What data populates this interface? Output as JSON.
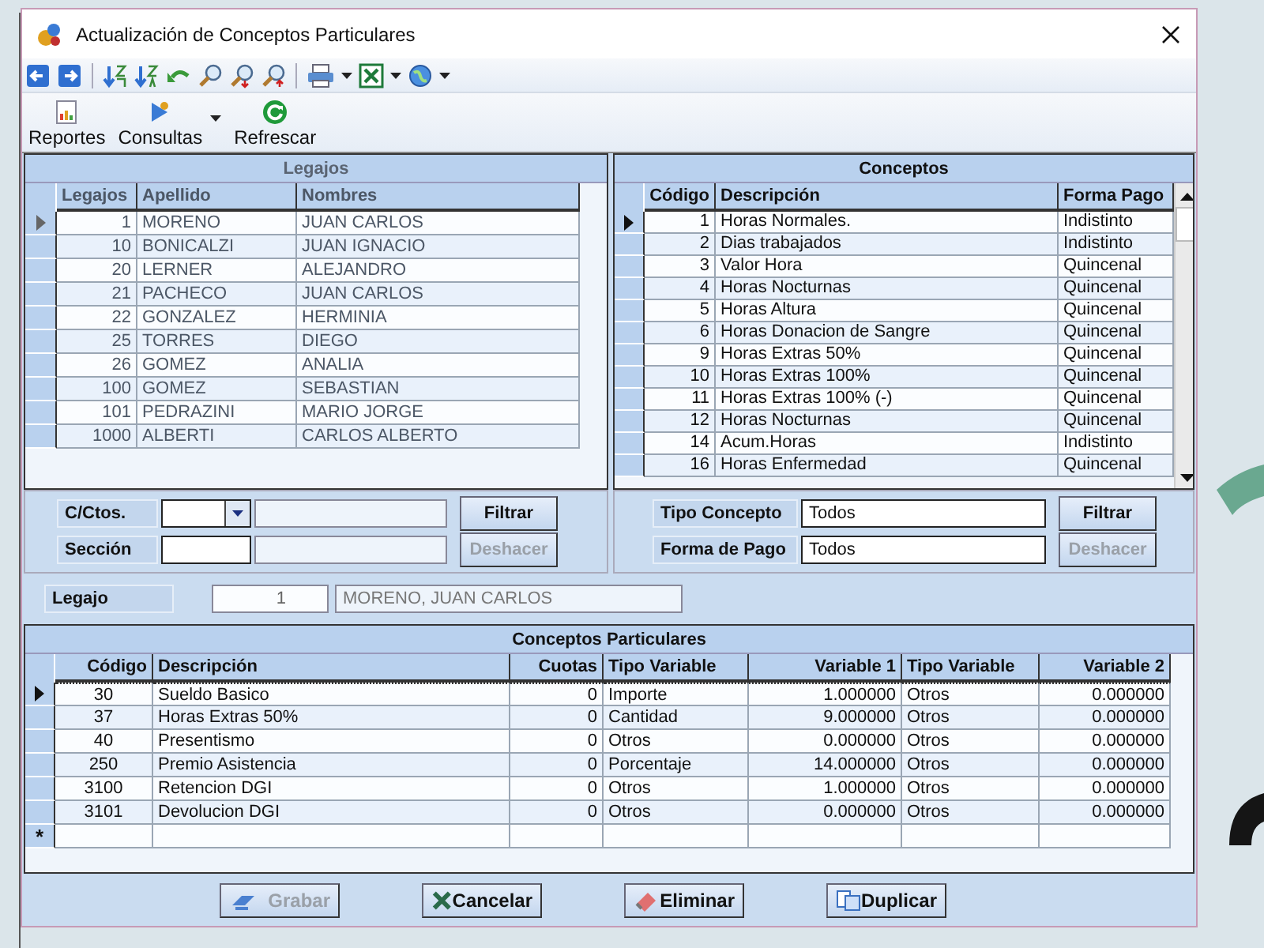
{
  "window": {
    "title": "Actualización de Conceptos Particulares"
  },
  "ribbon": [
    {
      "label": "Reportes",
      "kind": "report",
      "dropdown": false
    },
    {
      "label": "Consultas",
      "kind": "query",
      "dropdown": true
    },
    {
      "label": "Refrescar",
      "kind": "refresh",
      "dropdown": false
    }
  ],
  "legajos": {
    "title": "Legajos",
    "disabled": true,
    "columns": [
      "Legajos",
      "Apellido",
      "Nombres"
    ],
    "rows": [
      {
        "cells": [
          "1",
          "MORENO",
          "JUAN CARLOS"
        ],
        "selected": true
      },
      {
        "cells": [
          "10",
          "BONICALZI",
          "JUAN IGNACIO"
        ],
        "selected": false
      },
      {
        "cells": [
          "20",
          "LERNER",
          "ALEJANDRO"
        ],
        "selected": false
      },
      {
        "cells": [
          "21",
          "PACHECO",
          "JUAN CARLOS"
        ],
        "selected": false
      },
      {
        "cells": [
          "22",
          "GONZALEZ",
          "HERMINIA"
        ],
        "selected": false
      },
      {
        "cells": [
          "25",
          "TORRES",
          "DIEGO"
        ],
        "selected": false
      },
      {
        "cells": [
          "26",
          "GOMEZ",
          "ANALIA"
        ],
        "selected": false
      },
      {
        "cells": [
          "100",
          "GOMEZ",
          "SEBASTIAN"
        ],
        "selected": false
      },
      {
        "cells": [
          "101",
          "PEDRAZINI",
          "MARIO JORGE"
        ],
        "selected": false
      },
      {
        "cells": [
          "1000",
          "ALBERTI",
          "CARLOS ALBERTO"
        ],
        "selected": false
      }
    ]
  },
  "conceptos": {
    "title": "Conceptos",
    "disabled": false,
    "columns": [
      "Código",
      "Descripción",
      "Forma Pago"
    ],
    "rows": [
      {
        "cells": [
          "1",
          "Horas Normales.",
          "Indistinto"
        ],
        "selected": true
      },
      {
        "cells": [
          "2",
          "Dias trabajados",
          "Indistinto"
        ],
        "selected": false
      },
      {
        "cells": [
          "3",
          "Valor Hora",
          "Quincenal"
        ],
        "selected": false
      },
      {
        "cells": [
          "4",
          "Horas Nocturnas",
          "Quincenal"
        ],
        "selected": false
      },
      {
        "cells": [
          "5",
          "Horas Altura",
          "Quincenal"
        ],
        "selected": false
      },
      {
        "cells": [
          "6",
          "Horas Donacion de Sangre",
          "Quincenal"
        ],
        "selected": false
      },
      {
        "cells": [
          "9",
          "Horas Extras 50%",
          "Quincenal"
        ],
        "selected": false
      },
      {
        "cells": [
          "10",
          "Horas Extras 100%",
          "Quincenal"
        ],
        "selected": false
      },
      {
        "cells": [
          "11",
          "Horas Extras 100% (-)",
          "Quincenal"
        ],
        "selected": false
      },
      {
        "cells": [
          "12",
          "Horas Nocturnas",
          "Quincenal"
        ],
        "selected": false
      },
      {
        "cells": [
          "14",
          "Acum.Horas",
          "Indistinto"
        ],
        "selected": false
      },
      {
        "cells": [
          "16",
          "Horas Enfermedad",
          "Quincenal"
        ],
        "selected": false
      }
    ]
  },
  "filters_left": {
    "rows": [
      {
        "label": "C/Ctos.",
        "kind": "combo",
        "value": "",
        "button": {
          "label": "Filtrar",
          "disabled": false
        }
      },
      {
        "label": "Sección",
        "kind": "text",
        "value": "",
        "button": {
          "label": "Deshacer",
          "disabled": true
        }
      }
    ]
  },
  "filters_right": {
    "rows": [
      {
        "label": "Tipo Concepto",
        "kind": "text",
        "value": "Todos",
        "button": {
          "label": "Filtrar",
          "disabled": false
        }
      },
      {
        "label": "Forma de Pago",
        "kind": "text",
        "value": "Todos",
        "button": {
          "label": "Deshacer",
          "disabled": true
        }
      }
    ]
  },
  "legajo": {
    "label": "Legajo",
    "number": "1",
    "name": "MORENO, JUAN CARLOS"
  },
  "particulares": {
    "title": "Conceptos Particulares",
    "new_row_marker": "*",
    "columns": [
      "Código",
      "Descripción",
      "Cuotas",
      "Tipo Variable",
      "Variable 1",
      "Tipo Variable",
      "Variable 2"
    ],
    "rows": [
      {
        "cells": [
          "30",
          "Sueldo Basico",
          "0",
          "Importe",
          "1.000000",
          "Otros",
          "0.000000"
        ],
        "selected": true
      },
      {
        "cells": [
          "37",
          "Horas Extras 50%",
          "0",
          "Cantidad",
          "9.000000",
          "Otros",
          "0.000000"
        ],
        "selected": false
      },
      {
        "cells": [
          "40",
          "Presentismo",
          "0",
          "Otros",
          "0.000000",
          "Otros",
          "0.000000"
        ],
        "selected": false
      },
      {
        "cells": [
          "250",
          "Premio Asistencia",
          "0",
          "Porcentaje",
          "14.000000",
          "Otros",
          "0.000000"
        ],
        "selected": false
      },
      {
        "cells": [
          "3100",
          "Retencion DGI",
          "0",
          "Otros",
          "1.000000",
          "Otros",
          "0.000000"
        ],
        "selected": false
      },
      {
        "cells": [
          "3101",
          "Devolucion DGI",
          "0",
          "Otros",
          "0.000000",
          "Otros",
          "0.000000"
        ],
        "selected": false
      }
    ]
  },
  "actions": [
    {
      "label": "Grabar",
      "kind": "save",
      "disabled": true
    },
    {
      "label": "Cancelar",
      "kind": "cancel",
      "disabled": false
    },
    {
      "label": "Eliminar",
      "kind": "delete",
      "disabled": false
    },
    {
      "label": "Duplicar",
      "kind": "copy",
      "disabled": false
    }
  ]
}
